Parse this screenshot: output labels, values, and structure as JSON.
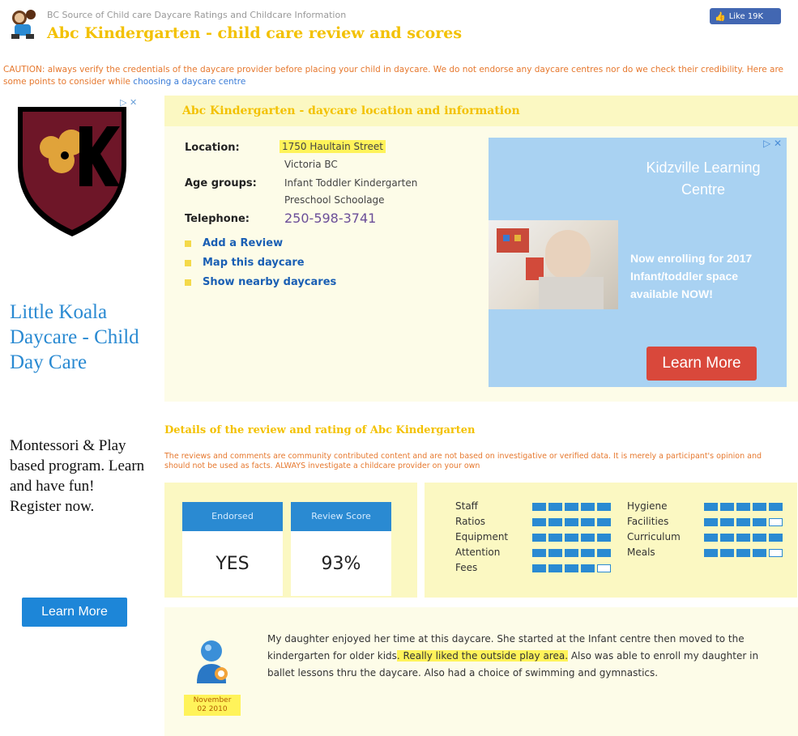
{
  "header": {
    "tagline": "BC Source of Child care Daycare Ratings and Childcare Information",
    "title": "Abc Kindergarten - child care review and scores",
    "fb_like": "Like 19K"
  },
  "caution": {
    "text": "CAUTION: always verify the credentials of the daycare provider before placing your child in daycare. We do not endorse any daycare centres nor do we check their credibility. Here are some points to consider while",
    "link": "choosing a daycare centre"
  },
  "left_ad": {
    "adchoice": "▷ ✕",
    "title": "Little Koala Daycare - Child Day Care",
    "body": "Montessori & Play based program. Learn and have fun! Register now.",
    "button": "Learn More"
  },
  "location_panel": {
    "heading": "Abc Kindergarten - daycare location and information",
    "location_label": "Location:",
    "location_line1": "1750 Haultain Street",
    "location_line2": "Victoria BC",
    "age_label": "Age groups:",
    "age_line1": "Infant Toddler Kindergarten",
    "age_line2": "Preschool Schoolage",
    "phone_label": "Telephone:",
    "phone": "250-598-3741",
    "links": [
      "Add a Review",
      "Map this daycare",
      "Show nearby daycares"
    ]
  },
  "right_ad": {
    "adchoice": "▷ ✕",
    "brand": "Kidzville Learning Centre",
    "message": "Now enrolling for 2017 Infant/toddler space available NOW!",
    "button": "Learn More"
  },
  "details": {
    "title": "Details of the review and rating of Abc Kindergarten",
    "note": "The reviews and comments are community contributed content and are not based on investigative or verified data. It is merely a participant's opinion and should not be used as facts. ALWAYS investigate a childcare provider on your own",
    "endorsed_label": "Endorsed",
    "endorsed_value": "YES",
    "score_label": "Review Score",
    "score_value": "93%"
  },
  "ratings": {
    "left": [
      {
        "label": "Staff",
        "filled": 5
      },
      {
        "label": "Ratios",
        "filled": 5
      },
      {
        "label": "Equipment",
        "filled": 5
      },
      {
        "label": "Attention",
        "filled": 5
      },
      {
        "label": "Fees",
        "filled": 4
      }
    ],
    "right": [
      {
        "label": "Hygiene",
        "filled": 5
      },
      {
        "label": "Facilities",
        "filled": 4
      },
      {
        "label": "Curriculum",
        "filled": 5
      },
      {
        "label": "Meals",
        "filled": 4
      }
    ],
    "max": 5
  },
  "review": {
    "date_line1": "November",
    "date_line2": "02 2010",
    "text_part1": "My daughter enjoyed her time at this daycare. She started at the Infant centre then moved to the kindergarten for older kids",
    "text_highlight": ". Really liked the outside play area.",
    "text_part2": " Also was able to enroll my daughter in ballet lessons thru the daycare. Also had a choice of swimming and gymnastics."
  },
  "colors": {
    "accent_yellow": "#f3c100",
    "caution_orange": "#e6782e",
    "brand_blue": "#2a8ad2",
    "panel_bg": "#fbf8c2",
    "highlight": "#fff35a"
  }
}
